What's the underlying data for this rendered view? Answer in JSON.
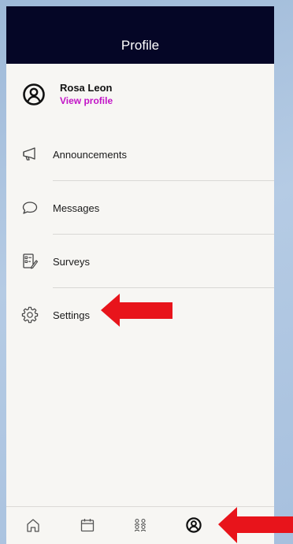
{
  "header": {
    "title": "Profile"
  },
  "profile": {
    "name": "Rosa Leon",
    "link": "View profile"
  },
  "menu": {
    "items": [
      {
        "label": "Announcements",
        "icon": "megaphone-icon"
      },
      {
        "label": "Messages",
        "icon": "chat-bubble-icon"
      },
      {
        "label": "Surveys",
        "icon": "survey-icon"
      },
      {
        "label": "Settings",
        "icon": "gear-icon"
      }
    ]
  },
  "tabbar": {
    "tabs": [
      {
        "icon": "home-icon"
      },
      {
        "icon": "calendar-icon"
      },
      {
        "icon": "people-icon"
      },
      {
        "icon": "profile-icon",
        "active": true
      }
    ]
  },
  "colors": {
    "header_bg": "#050626",
    "link": "#c214c7",
    "annotation_arrow": "#e8141b"
  }
}
